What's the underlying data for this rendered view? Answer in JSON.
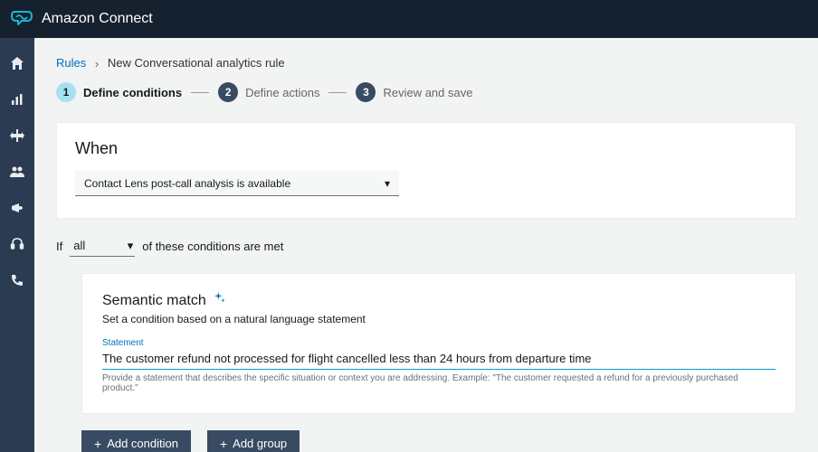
{
  "header": {
    "product": "Amazon Connect"
  },
  "breadcrumb": {
    "root": "Rules",
    "current": "New Conversational analytics rule"
  },
  "steps": [
    {
      "num": "1",
      "label": "Define conditions",
      "active": true
    },
    {
      "num": "2",
      "label": "Define actions",
      "active": false
    },
    {
      "num": "3",
      "label": "Review and save",
      "active": false
    }
  ],
  "when": {
    "heading": "When",
    "selected": "Contact Lens post-call analysis is available"
  },
  "if_bar": {
    "prefix": "If",
    "scope": "all",
    "suffix": "of these conditions are met"
  },
  "condition": {
    "title": "Semantic match",
    "description": "Set a condition based on a natural language statement",
    "field_label": "Statement",
    "field_value": "The customer refund not processed for flight cancelled less than 24 hours from departure time",
    "field_hint": "Provide a statement that describes the specific situation or context you are addressing. Example: \"The customer requested a refund for a previously purchased product.\""
  },
  "actions": {
    "add_condition": "Add condition",
    "add_group": "Add group"
  },
  "nav_icons": [
    "home",
    "analytics",
    "routing",
    "users",
    "campaigns",
    "support",
    "calls"
  ]
}
